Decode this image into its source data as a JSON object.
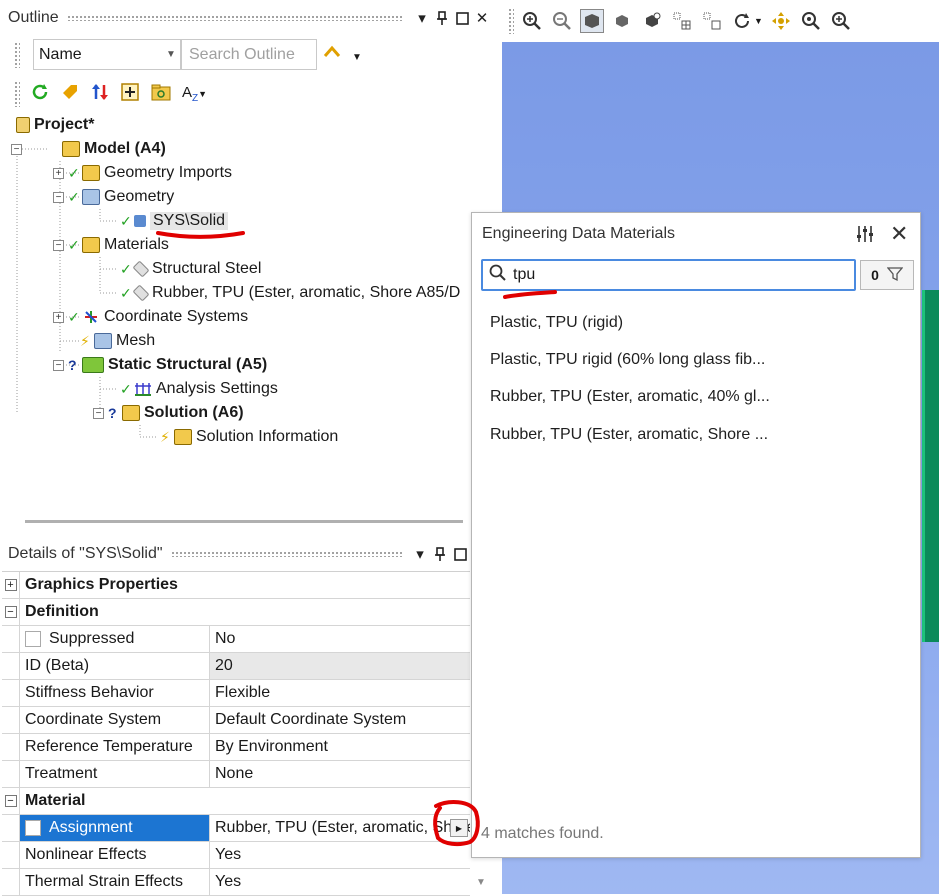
{
  "outline": {
    "title": "Outline",
    "filter_select": "Name",
    "search_placeholder": "Search Outline",
    "tree": [
      {
        "label": "Project*",
        "bold": true
      },
      {
        "label": "Model (A4)",
        "bold": true
      },
      {
        "label": "Geometry Imports"
      },
      {
        "label": "Geometry"
      },
      {
        "label": "SYS\\Solid"
      },
      {
        "label": "Materials"
      },
      {
        "label": "Structural Steel"
      },
      {
        "label": "Rubber, TPU (Ester, aromatic, Shore A85/D"
      },
      {
        "label": "Coordinate Systems"
      },
      {
        "label": "Mesh"
      },
      {
        "label": "Static Structural (A5)",
        "bold": true
      },
      {
        "label": "Analysis Settings"
      },
      {
        "label": "Solution (A6)",
        "bold": true
      },
      {
        "label": "Solution Information"
      }
    ]
  },
  "details": {
    "title": "Details of \"SYS\\Solid\"",
    "rows": [
      {
        "type": "section",
        "label": "Graphics Properties",
        "expander": "+"
      },
      {
        "type": "section",
        "label": "Definition",
        "expander": "−"
      },
      {
        "key": "Suppressed",
        "value": "No",
        "checkbox": true
      },
      {
        "key": "ID (Beta)",
        "value": "20",
        "readonly": true
      },
      {
        "key": "Stiffness Behavior",
        "value": "Flexible"
      },
      {
        "key": "Coordinate System",
        "value": "Default Coordinate System"
      },
      {
        "key": "Reference Temperature",
        "value": "By Environment"
      },
      {
        "key": "Treatment",
        "value": "None"
      },
      {
        "type": "section",
        "label": "Material",
        "expander": "−"
      },
      {
        "key": "Assignment",
        "value": "Rubber, TPU (Ester, aromatic, Shore",
        "checkbox": true,
        "selected": true
      },
      {
        "key": "Nonlinear Effects",
        "value": "Yes"
      },
      {
        "key": "Thermal Strain Effects",
        "value": "Yes"
      }
    ]
  },
  "popup": {
    "title": "Engineering Data Materials",
    "search_value": "tpu",
    "filter_count": "0",
    "results": [
      "Plastic, TPU (rigid)",
      "Plastic, TPU rigid (60% long glass fib...",
      "Rubber, TPU (Ester, aromatic, 40% gl...",
      "Rubber, TPU (Ester, aromatic, Shore ..."
    ],
    "match_count": "4 matches found."
  },
  "colors": {
    "selection": "#1c75d2",
    "viewport": "#7b9ae6",
    "annotation": "#e00000",
    "check": "#20a020"
  }
}
